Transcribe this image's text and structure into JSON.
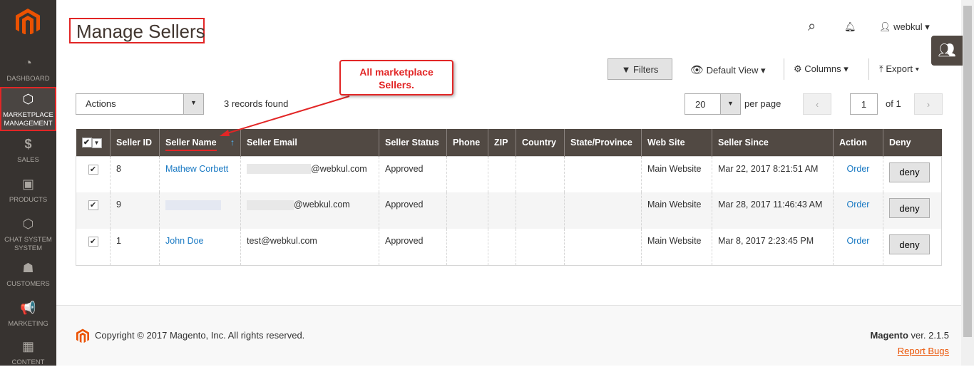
{
  "sidebar": {
    "items": [
      {
        "label": "DASHBOARD",
        "icon": "dashboard-icon"
      },
      {
        "label": "MARKETPLACE MANAGEMENT",
        "icon": "hexagon-icon"
      },
      {
        "label": "SALES",
        "icon": "dollar-icon"
      },
      {
        "label": "PRODUCTS",
        "icon": "box-icon"
      },
      {
        "label": "CHAT SYSTEM SYSTEM",
        "icon": "hexagon-icon"
      },
      {
        "label": "CUSTOMERS",
        "icon": "person-icon"
      },
      {
        "label": "MARKETING",
        "icon": "megaphone-icon"
      },
      {
        "label": "CONTENT",
        "icon": "layout-icon"
      }
    ]
  },
  "header": {
    "title": "Manage Sellers",
    "user": "webkul"
  },
  "toolbar": {
    "filters": "Filters",
    "view": "Default View",
    "columns": "Columns",
    "export": "Export",
    "actions": "Actions",
    "records": "3 records found",
    "per_page_value": "20",
    "per_page_label": "per page",
    "page": "1",
    "of": "of 1"
  },
  "annotation": {
    "text": "All marketplace Sellers."
  },
  "table": {
    "headers": [
      "Seller ID",
      "Seller Name",
      "Seller Email",
      "Seller Status",
      "Phone",
      "ZIP",
      "Country",
      "State/Province",
      "Web Site",
      "Seller Since",
      "Action",
      "Deny"
    ],
    "rows": [
      {
        "id": "8",
        "name": "Mathew Corbett",
        "email": "@webkul.com",
        "status": "Approved",
        "site": "Main Website",
        "since": "Mar 22, 2017 8:21:51 AM",
        "action": "Order",
        "deny": "deny"
      },
      {
        "id": "9",
        "name": "",
        "email": "@webkul.com",
        "status": "Approved",
        "site": "Main Website",
        "since": "Mar 28, 2017 11:46:43 AM",
        "action": "Order",
        "deny": "deny"
      },
      {
        "id": "1",
        "name": "John Doe",
        "email": "test@webkul.com",
        "status": "Approved",
        "site": "Main Website",
        "since": "Mar 8, 2017 2:23:45 PM",
        "action": "Order",
        "deny": "deny"
      }
    ]
  },
  "footer": {
    "copyright": "Copyright © 2017 Magento, Inc. All rights reserved.",
    "brand": "Magento",
    "version": " ver. 2.1.5",
    "report": "Report Bugs"
  },
  "colors": {
    "accent": "#eb5202",
    "header": "#514943",
    "link": "#1979c3",
    "annotation": "#e22626"
  }
}
